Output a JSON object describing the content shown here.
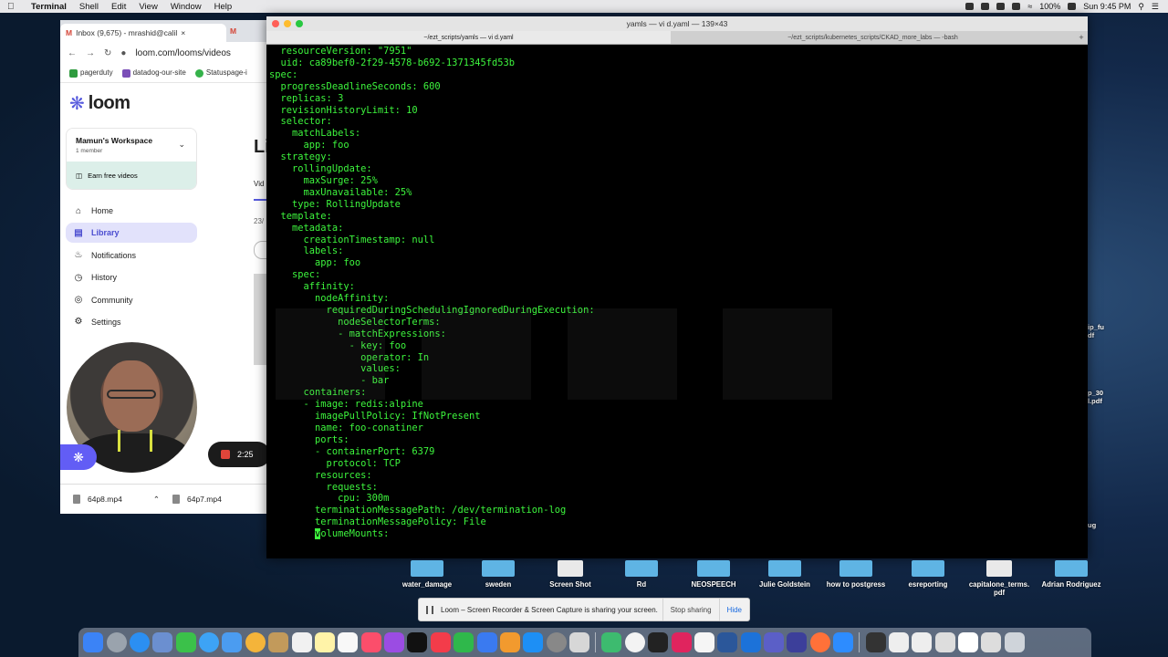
{
  "menubar": {
    "app": "Terminal",
    "items": [
      "Shell",
      "Edit",
      "View",
      "Window",
      "Help"
    ],
    "battery": "100%",
    "clock": "Sun 9:45 PM"
  },
  "browser": {
    "tab1_title": "Inbox (9,675) - mrashid@calil",
    "url": "loom.com/looms/videos",
    "bookmarks": [
      "pagerduty",
      "datadog-our-site",
      "Statuspage-i"
    ]
  },
  "loom": {
    "brand": "loom",
    "workspace_name": "Mamun's Workspace",
    "workspace_members": "1 member",
    "earn": "Earn free videos",
    "nav": [
      {
        "label": "Home",
        "icon": "home-icon"
      },
      {
        "label": "Library",
        "icon": "library-icon"
      },
      {
        "label": "Notifications",
        "icon": "bell-icon"
      },
      {
        "label": "History",
        "icon": "clock-icon"
      },
      {
        "label": "Community",
        "icon": "globe-icon"
      },
      {
        "label": "Settings",
        "icon": "gear-icon"
      }
    ],
    "recording_time": "2:25",
    "page_title_fragment": "Li",
    "tab_fragment": "Vid",
    "date_fragment": "23/"
  },
  "downloads": [
    "64p8.mp4",
    "64p7.mp4"
  ],
  "terminal": {
    "title": "yamls — vi d.yaml — 139×43",
    "tab_active": "~/ezt_scripts/yamls — vi d.yaml",
    "tab_other": "~/ezt_scripts/kubernetes_scripts/CKAD_more_labs — -bash",
    "lines_before_cursor": "  resourceVersion: \"7951\"\n  uid: ca89bef0-2f29-4578-b692-1371345fd53b\nspec:\n  progressDeadlineSeconds: 600\n  replicas: 3\n  revisionHistoryLimit: 10\n  selector:\n    matchLabels:\n      app: foo\n  strategy:\n    rollingUpdate:\n      maxSurge: 25%\n      maxUnavailable: 25%\n    type: RollingUpdate\n  template:\n    metadata:\n      creationTimestamp: null\n      labels:\n        app: foo\n    spec:\n      affinity:\n        nodeAffinity:\n          requiredDuringSchedulingIgnoredDuringExecution:\n            nodeSelectorTerms:\n            - matchExpressions:\n              - key: foo\n                operator: In\n                values:\n                - bar\n      containers:\n      - image: redis:alpine\n        imagePullPolicy: IfNotPresent\n        name: foo-conatiner\n        ports:\n        - containerPort: 6379\n          protocol: TCP\n        resources:\n          requests:\n            cpu: 300m\n        terminationMessagePath: /dev/termination-log\n        terminationMessagePolicy: File\n        ",
    "cursor_char": "v",
    "after_cursor": "olumeMounts:"
  },
  "desktop_icons": [
    "water_damage",
    "sweden",
    "Screen Shot",
    "Rd",
    "NEOSPEECH",
    "Julie Goldstein",
    "how to postgress",
    "esreporting",
    "capitalone_terms.\npdf",
    "Adrian Rodriguez"
  ],
  "right_labels": [
    "ip_fu\ndf",
    "p_30\nl.pdf",
    "ug"
  ],
  "sharing": {
    "message": "Loom – Screen Recorder & Screen Capture is sharing your screen.",
    "stop": "Stop sharing",
    "hide": "Hide"
  }
}
